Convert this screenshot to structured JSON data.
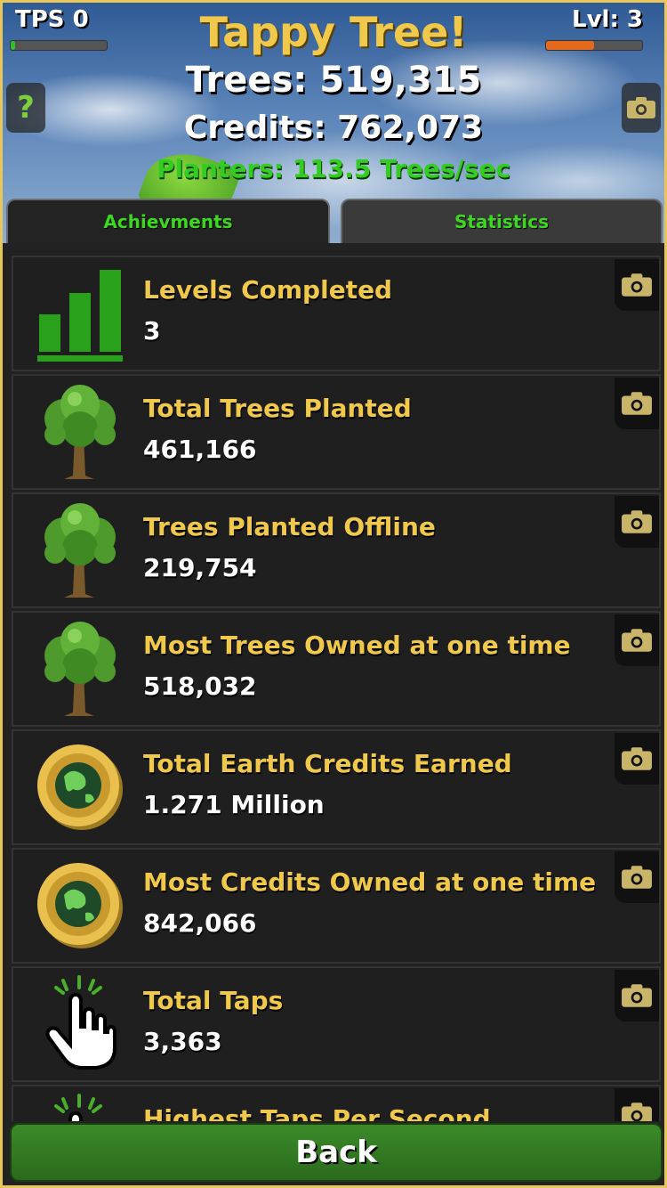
{
  "header": {
    "tps_label": "TPS 0",
    "tps_progress": 0.05,
    "level_label": "Lvl: 3",
    "level_progress": 0.5,
    "title": "Tappy Tree!",
    "trees": "Trees: 519,315",
    "credits": "Credits: 762,073",
    "planters": "Planters: 113.5 Trees/sec",
    "help_symbol": "?"
  },
  "tabs": {
    "achievements": "Achievments",
    "statistics": "Statistics",
    "active": "statistics"
  },
  "stats": [
    {
      "icon": "bar-chart-icon",
      "label": "Levels Completed",
      "value": "3"
    },
    {
      "icon": "tree-icon",
      "label": "Total Trees Planted",
      "value": "461,166"
    },
    {
      "icon": "tree-icon",
      "label": "Trees Planted Offline",
      "value": "219,754"
    },
    {
      "icon": "tree-icon",
      "label": "Most Trees Owned at one time",
      "value": "518,032"
    },
    {
      "icon": "earth-coin-icon",
      "label": "Total Earth Credits Earned",
      "value": "1.271 Million"
    },
    {
      "icon": "earth-coin-icon",
      "label": "Most Credits Owned at one time",
      "value": "842,066"
    },
    {
      "icon": "tap-hand-icon",
      "label": "Total Taps",
      "value": "3,363"
    },
    {
      "icon": "tap-hand-icon",
      "label": "Highest Taps Per Second",
      "value": ""
    }
  ],
  "back_label": "Back",
  "colors": {
    "gold": "#f0c84c",
    "green_text": "#33cc22",
    "tps_bar": "#2fbf2a",
    "level_bar": "#e36a1c"
  }
}
